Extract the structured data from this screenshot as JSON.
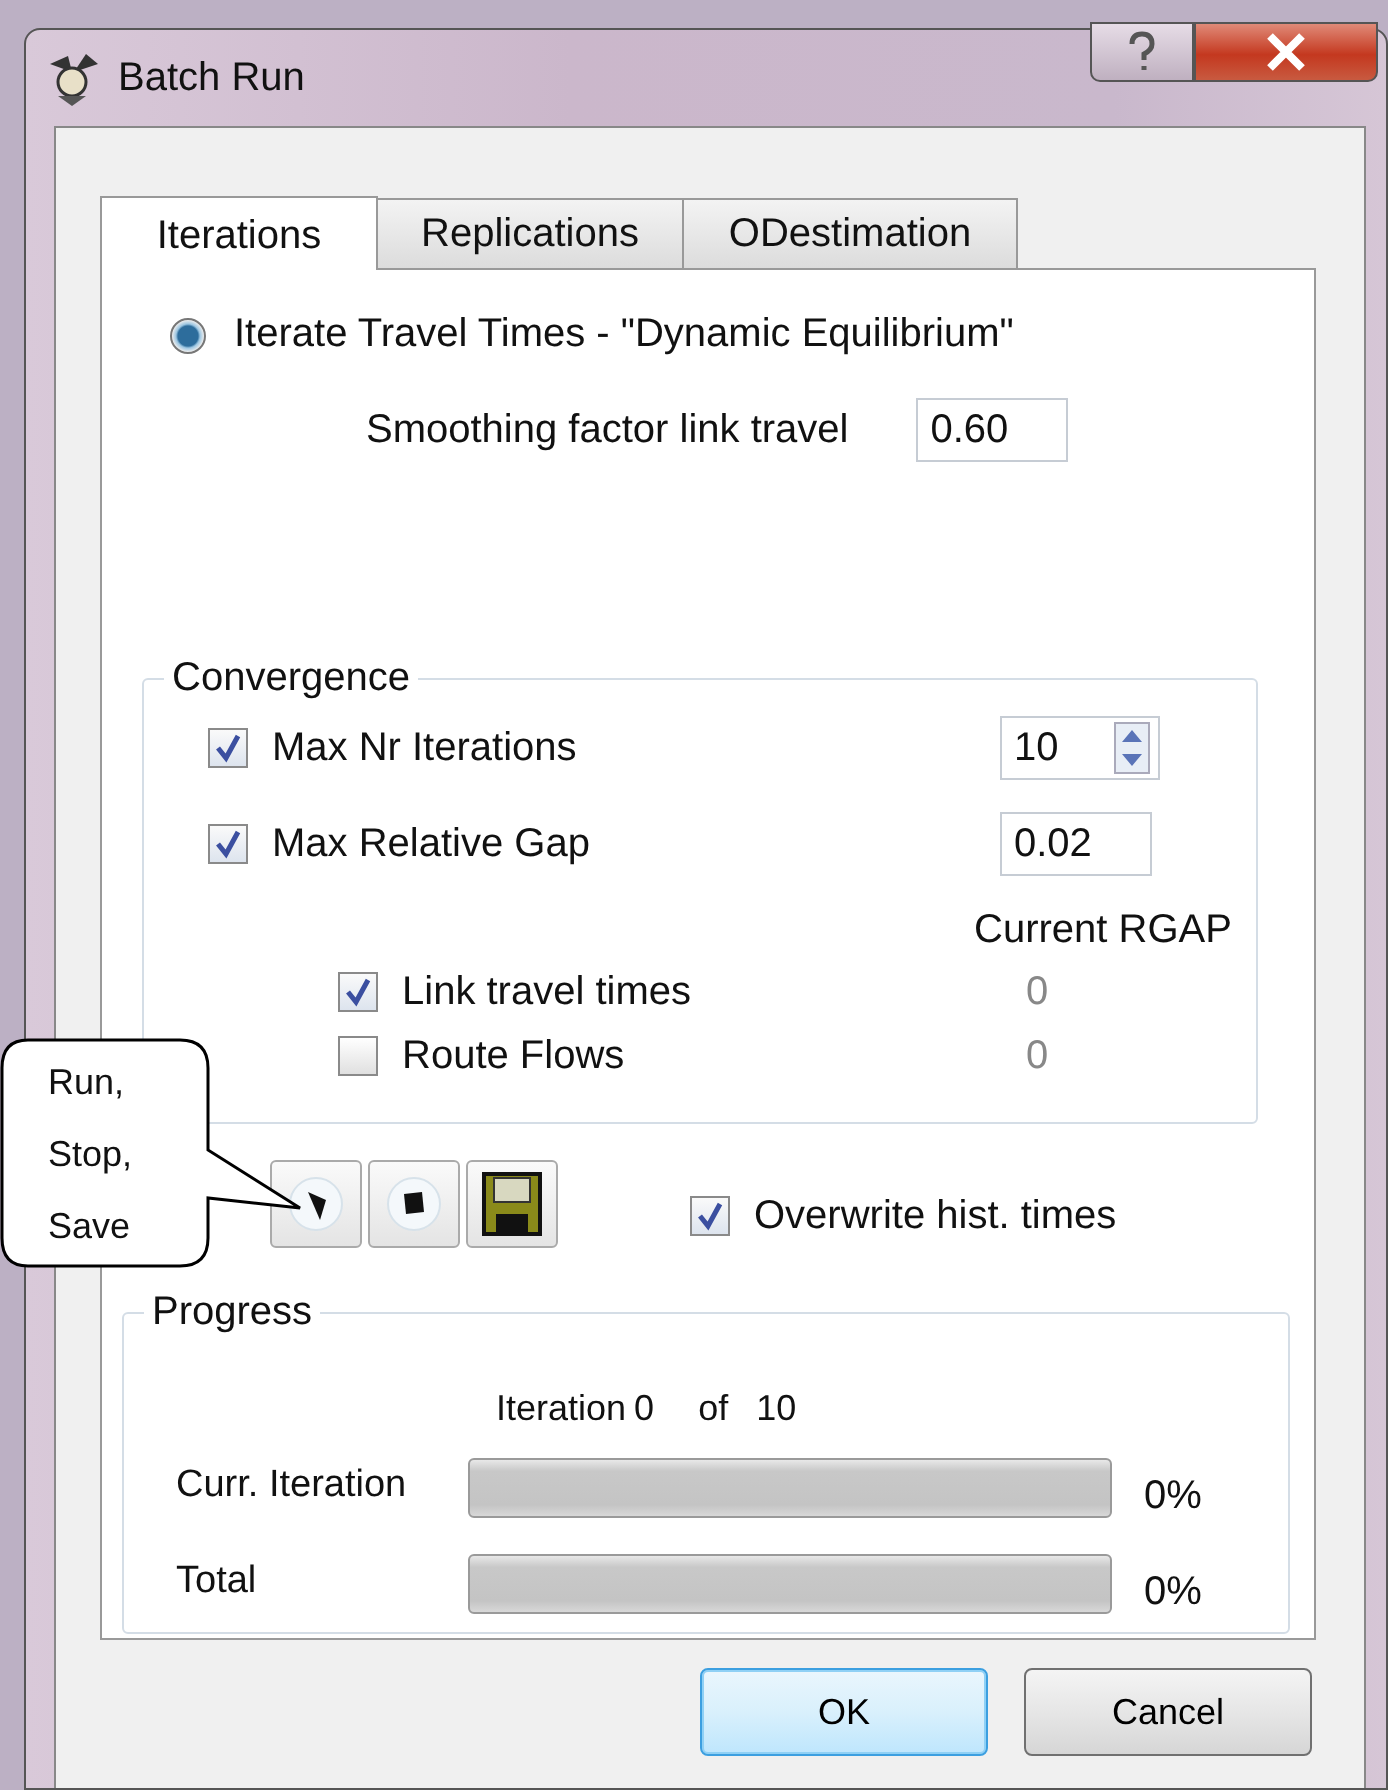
{
  "window": {
    "title": "Batch Run"
  },
  "tabs": [
    {
      "label": "Iterations",
      "selected": true
    },
    {
      "label": "Replications",
      "selected": false
    },
    {
      "label": "ODestimation",
      "selected": false
    }
  ],
  "mode": {
    "label": "Iterate Travel Times - \"Dynamic Equilibrium\"",
    "selected": true
  },
  "smoothing": {
    "label": "Smoothing factor link travel",
    "value": "0.60"
  },
  "convergence": {
    "title": "Convergence",
    "limits": [
      {
        "label": "Max Nr Iterations",
        "checked": true,
        "kind": "spin",
        "value": "10"
      },
      {
        "label": "Max Relative Gap",
        "checked": true,
        "kind": "text",
        "value": "0.02"
      }
    ],
    "rgap_header": "Current RGAP",
    "criteria": [
      {
        "label": "Link travel times",
        "checked": true,
        "rgap": "0"
      },
      {
        "label": "Route Flows",
        "checked": false,
        "rgap": "0"
      }
    ]
  },
  "toolbar": [
    {
      "kind": "run"
    },
    {
      "kind": "stop"
    },
    {
      "kind": "save"
    }
  ],
  "overwrite": {
    "label": "Overwrite hist. times",
    "checked": true
  },
  "callout": {
    "text": "Run, Stop, Save"
  },
  "progress": {
    "title": "Progress",
    "iteration_label": "Iteration",
    "iteration": "0",
    "of": "of",
    "total": "10",
    "bars": [
      {
        "label": "Curr. Iteration",
        "level": 0,
        "reading": "0%"
      },
      {
        "label": "Total",
        "level": 0,
        "reading": "0%"
      }
    ]
  },
  "buttons": [
    {
      "label": "OK",
      "default": true
    },
    {
      "label": "Cancel",
      "default": false
    }
  ]
}
